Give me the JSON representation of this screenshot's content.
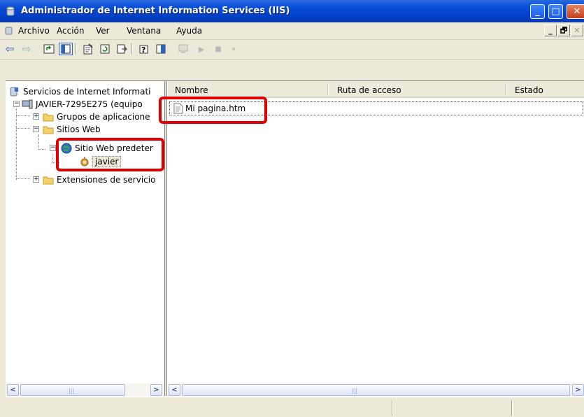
{
  "window": {
    "title": "Administrador de Internet Information Services (IIS)",
    "minimize_glyph": "_",
    "maximize_glyph": "□",
    "close_glyph": "✕"
  },
  "menubar": {
    "items": [
      "Archivo",
      "Acción",
      "Ver",
      "Ventana",
      "Ayuda"
    ],
    "mdi_minimize": "_",
    "mdi_restore": "🗗",
    "mdi_close": "✕"
  },
  "toolbar": {
    "back_glyph": "⇦",
    "forward_glyph": "⇨",
    "play_glyph": "▶",
    "stop_glyph": "■",
    "pause_glyph": "⏸"
  },
  "tree": {
    "root": "Servicios de Internet Informati",
    "computer": "JAVIER-7295E275 (equipo",
    "app_pools": "Grupos de aplicacione",
    "websites": "Sitios Web",
    "default_site": "Sitio Web predeter",
    "vdir": "javier",
    "extensions": "Extensiones de servicio"
  },
  "list": {
    "columns": [
      "Nombre",
      "Ruta de acceso",
      "Estado"
    ],
    "rows": [
      {
        "name": "Mi pagina.htm"
      }
    ]
  },
  "scroll": {
    "left_arrow": "<",
    "right_arrow": ">",
    "grip": "|||"
  },
  "colors": {
    "titlebar": "#0a4fd6",
    "highlight": "#e00000",
    "face": "#ece9d8"
  }
}
